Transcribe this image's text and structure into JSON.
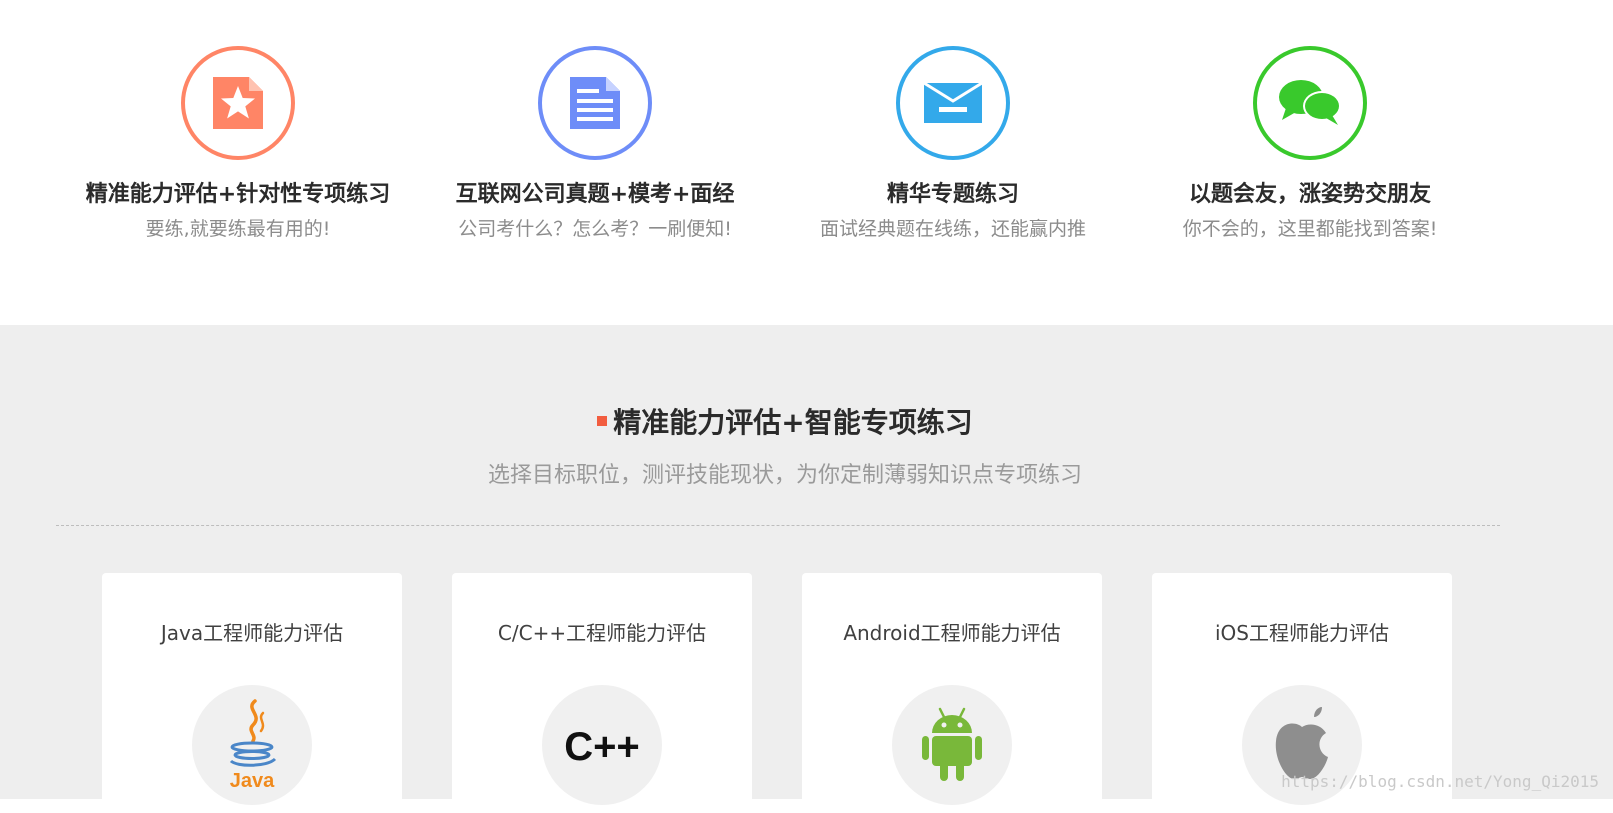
{
  "features": [
    {
      "icon": "star-document-icon",
      "color": "#ff8566",
      "title": "精准能力评估+针对性专项练习",
      "subtitle": "要练,就要练最有用的!"
    },
    {
      "icon": "document-icon",
      "color": "#6e8df8",
      "title": "互联网公司真题+模考+面经",
      "subtitle": "公司考什么？怎么考？一刷便知!"
    },
    {
      "icon": "envelope-icon",
      "color": "#33a9ea",
      "title": "精华专题练习",
      "subtitle": "面试经典题在线练，还能赢内推"
    },
    {
      "icon": "chat-bubbles-icon",
      "color": "#39c92c",
      "title": "以题会友，涨姿势交朋友",
      "subtitle": "你不会的，这里都能找到答案!"
    }
  ],
  "section": {
    "heading": "精准能力评估+智能专项练习",
    "subheading": "选择目标职位，测评技能现状，为你定制薄弱知识点专项练习"
  },
  "cards": [
    {
      "title": "Java工程师能力评估",
      "logo": "java-logo-icon",
      "logo_text": "Java"
    },
    {
      "title": "C/C++工程师能力评估",
      "logo": "cpp-logo-icon",
      "logo_text": "C++"
    },
    {
      "title": "Android工程师能力评估",
      "logo": "android-logo-icon"
    },
    {
      "title": "iOS工程师能力评估",
      "logo": "apple-logo-icon"
    }
  ],
  "watermark": "https://blog.csdn.net/Yong_Qi2015",
  "colors": {
    "accent": "#f25d3f",
    "section_bg": "#eeeeee",
    "java_orange": "#f08a1c",
    "android_green": "#79b83a",
    "apple_gray": "#8e8e8e"
  }
}
